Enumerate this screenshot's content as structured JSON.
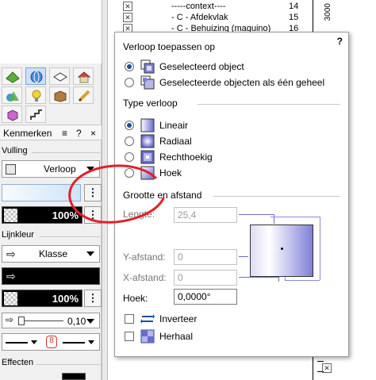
{
  "background": {
    "rows": [
      {
        "text": "-----context----",
        "num": "14"
      },
      {
        "text": "- C - Afdekvlak",
        "num": "15"
      },
      {
        "text": "- C - Behuizing (maquino)",
        "num": "16"
      }
    ],
    "ruler_label": "3000"
  },
  "left_panel": {
    "header": "Kenmerken",
    "header_icons": {
      "menu": "≡",
      "help": "?",
      "close": "×"
    },
    "vulling_label": "Vulling",
    "vulling_value": "Verloop",
    "fill_opacity": "100%",
    "lijnkleur_label": "Lijnkleur",
    "lijnkleur_value": "Klasse",
    "line_opacity": "100%",
    "line_weight": "0,10",
    "effecten_label": "Effecten",
    "dots": "⋮"
  },
  "popup": {
    "help": "?",
    "apply_title": "Verloop toepassen op",
    "apply_options": [
      {
        "label": "Geselecteerd object",
        "selected": true,
        "icon": "single-object-icon"
      },
      {
        "label": "Geselecteerde objecten als één geheel",
        "selected": false,
        "icon": "multiple-objects-icon"
      }
    ],
    "type_title": "Type verloop",
    "type_options": [
      {
        "label": "Lineair",
        "selected": true,
        "icon": "linear-gradient-icon"
      },
      {
        "label": "Radiaal",
        "selected": false,
        "icon": "radial-gradient-icon"
      },
      {
        "label": "Rechthoekig",
        "selected": false,
        "icon": "rectangular-gradient-icon"
      },
      {
        "label": "Hoek",
        "selected": false,
        "icon": "angle-gradient-icon"
      }
    ],
    "size_title": "Grootte en afstand",
    "lengte_label": "Lengte:",
    "lengte_value": "25,4",
    "y_label": "Y-afstand:",
    "y_value": "0",
    "x_label": "X-afstand:",
    "x_value": "0",
    "hoek_label": "Hoek:",
    "hoek_value": "0,0000°",
    "inverteer_label": "Inverteer",
    "herhaal_label": "Herhaal"
  },
  "colors": {
    "accent": "#1c4f9c",
    "annotation": "#e0202a",
    "gradient_dark": "#7f7fd6"
  }
}
